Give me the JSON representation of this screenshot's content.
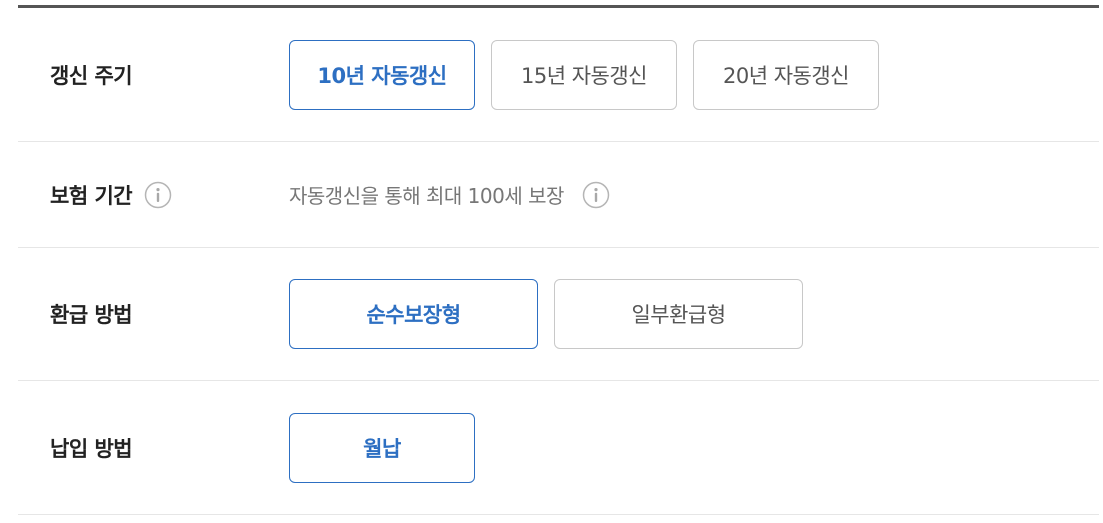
{
  "rows": {
    "renewal": {
      "label": "갱신 주기",
      "options": [
        {
          "label": "10년 자동갱신",
          "selected": true
        },
        {
          "label": "15년 자동갱신",
          "selected": false
        },
        {
          "label": "20년 자동갱신",
          "selected": false
        }
      ]
    },
    "coverage_period": {
      "label": "보험 기간",
      "value": "자동갱신을 통해 최대 100세 보장",
      "label_icon": "info-icon",
      "value_icon": "info-icon"
    },
    "refund_method": {
      "label": "환급 방법",
      "options": [
        {
          "label": "순수보장형",
          "selected": true
        },
        {
          "label": "일부환급형",
          "selected": false
        }
      ]
    },
    "payment_method": {
      "label": "납입 방법",
      "options": [
        {
          "label": "월납",
          "selected": true
        }
      ]
    }
  },
  "colors": {
    "accent": "#2d6fc2",
    "border": "#c8c8c8",
    "divider": "#e6e6e6",
    "top_rule": "#555555",
    "muted_text": "#777777"
  }
}
